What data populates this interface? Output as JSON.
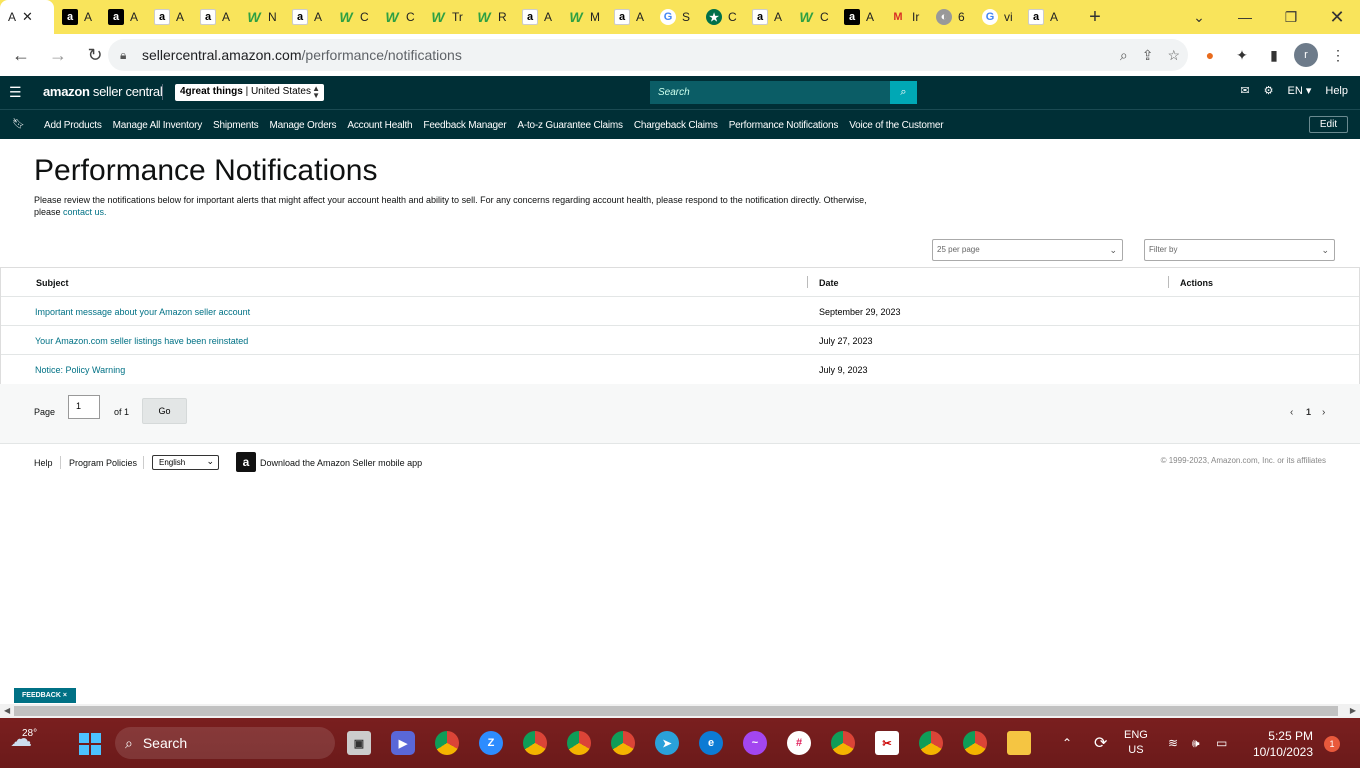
{
  "browser": {
    "tabs": [
      {
        "favicon": "amazon-text-icon",
        "label": "A"
      },
      {
        "favicon": "amazon-black-icon",
        "label": "A"
      },
      {
        "favicon": "amazon-black-icon",
        "label": "A"
      },
      {
        "favicon": "amazon-white-icon",
        "label": "A"
      },
      {
        "favicon": "amazon-white-icon",
        "label": "A"
      },
      {
        "favicon": "w-green-icon",
        "label": "N"
      },
      {
        "favicon": "amazon-white-icon",
        "label": "A"
      },
      {
        "favicon": "w-green-icon",
        "label": "C"
      },
      {
        "favicon": "w-green-icon",
        "label": "C"
      },
      {
        "favicon": "w-green-icon",
        "label": "Tr"
      },
      {
        "favicon": "w-green-icon",
        "label": "R"
      },
      {
        "favicon": "amazon-white-icon",
        "label": "A"
      },
      {
        "favicon": "w-green-icon",
        "label": "M"
      },
      {
        "favicon": "amazon-white-icon",
        "label": "A"
      },
      {
        "favicon": "google-icon",
        "label": "S"
      },
      {
        "favicon": "starbucks-icon",
        "label": "C"
      },
      {
        "favicon": "amazon-white-icon",
        "label": "A"
      },
      {
        "favicon": "w-green-icon",
        "label": "C"
      },
      {
        "favicon": "amazon-black-icon",
        "label": "A"
      },
      {
        "favicon": "gmail-icon",
        "label": "Ir"
      },
      {
        "favicon": "globe-icon",
        "label": "6"
      },
      {
        "favicon": "google-icon",
        "label": "vi"
      },
      {
        "favicon": "amazon-white-icon",
        "label": "A"
      }
    ],
    "url_host": "sellercentral.amazon.com",
    "url_path": "/performance/notifications"
  },
  "header": {
    "logo_main": "amazon",
    "logo_sub": " seller central",
    "account_name": "4great things",
    "account_region": " | United States",
    "search_placeholder": "Search",
    "lang": "EN ▾",
    "help": "Help"
  },
  "nav": {
    "items": [
      "Add Products",
      "Manage All Inventory",
      "Shipments",
      "Manage Orders",
      "Account Health",
      "Feedback Manager",
      "A-to-z Guarantee Claims",
      "Chargeback Claims",
      "Performance Notifications",
      "Voice of the Customer"
    ],
    "edit": "Edit"
  },
  "main": {
    "title": "Performance Notifications",
    "intro_text": "Please review the notifications below for important alerts that might affect your account health and ability to sell. For any concerns regarding account health, please respond to the notification directly. Otherwise, please ",
    "intro_link": "contact us.",
    "per_page": "25 per page",
    "filter_placeholder": "Filter by",
    "columns": {
      "subject": "Subject",
      "date": "Date",
      "actions": "Actions"
    },
    "rows": [
      {
        "subject": "Important message about your Amazon seller account",
        "date": "September 29, 2023"
      },
      {
        "subject": "Your Amazon.com seller listings have been reinstated",
        "date": "July 27, 2023"
      },
      {
        "subject": "Notice: Policy Warning",
        "date": "July 9, 2023"
      }
    ],
    "pager": {
      "page_label": "Page",
      "page_value": "1",
      "of_label": "of 1",
      "go": "Go",
      "current": "1"
    }
  },
  "footer": {
    "help": "Help",
    "policies": "Program Policies",
    "language": "English",
    "app": "Download the Amazon Seller mobile app",
    "copyright": "© 1999-2023, Amazon.com, Inc. or its affiliates"
  },
  "feedback": "FEEDBACK ×",
  "taskbar": {
    "temp": "28°",
    "search": "Search",
    "lang1": "ENG",
    "lang2": "US",
    "time": "5:25 PM",
    "date": "10/10/2023",
    "notifications": "1"
  }
}
